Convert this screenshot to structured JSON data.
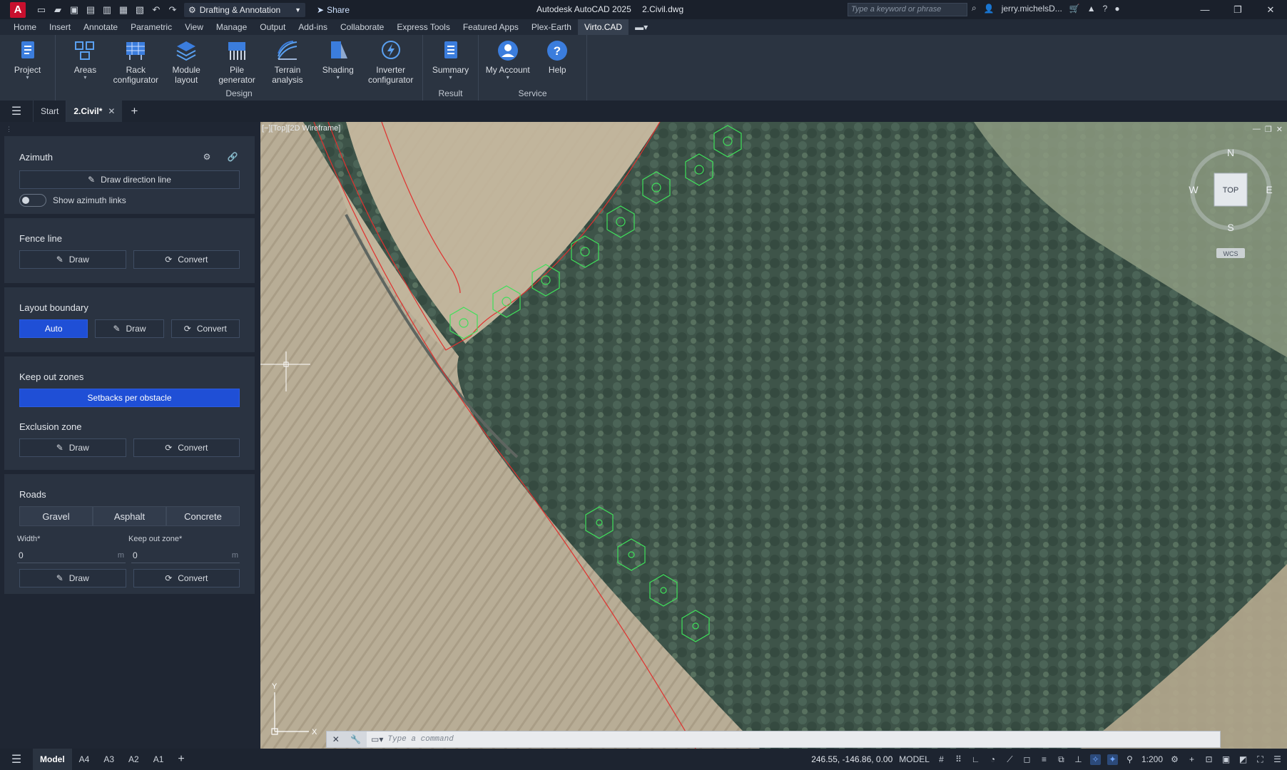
{
  "title": {
    "app": "Autodesk AutoCAD 2025",
    "file": "2.Civil.dwg"
  },
  "workspace": "Drafting & Annotation",
  "share_label": "Share",
  "search_placeholder": "Type a keyword or phrase",
  "user": "jerry.michelsD...",
  "menu": [
    "Home",
    "Insert",
    "Annotate",
    "Parametric",
    "View",
    "Manage",
    "Output",
    "Add-ins",
    "Collaborate",
    "Express Tools",
    "Featured Apps",
    "Plex-Earth",
    "Virto.CAD"
  ],
  "ribbon": {
    "project": "Project",
    "design": [
      "Areas",
      "Rack configurator",
      "Module layout",
      "Pile generator",
      "Terrain analysis",
      "Shading",
      "Inverter configurator"
    ],
    "design_label": "Design",
    "summary": "Summary",
    "result_label": "Result",
    "my_account": "My Account",
    "help": "Help",
    "service_label": "Service"
  },
  "doctabs": {
    "start": "Start",
    "active": "2.Civil*"
  },
  "panel": {
    "azimuth": {
      "title": "Azimuth",
      "draw_direction": "Draw direction line",
      "toggle_label": "Show azimuth links"
    },
    "fence": {
      "title": "Fence line",
      "draw": "Draw",
      "convert": "Convert"
    },
    "boundary": {
      "title": "Layout boundary",
      "auto": "Auto",
      "draw": "Draw",
      "convert": "Convert"
    },
    "keepout": {
      "title": "Keep out zones",
      "setbacks": "Setbacks per obstacle"
    },
    "exclusion": {
      "title": "Exclusion zone",
      "draw": "Draw",
      "convert": "Convert"
    },
    "roads": {
      "title": "Roads",
      "types": [
        "Gravel",
        "Asphalt",
        "Concrete"
      ],
      "width_label": "Width*",
      "keepout_label": "Keep out zone*",
      "width_value": "0",
      "keepout_value": "0",
      "unit": "m",
      "draw": "Draw",
      "convert": "Convert"
    }
  },
  "viewport": {
    "label": "[−][Top][2D Wireframe]",
    "compass": {
      "n": "N",
      "s": "S",
      "e": "E",
      "w": "W",
      "top": "TOP",
      "wcs": "WCS"
    },
    "ucs_x": "X",
    "ucs_y": "Y"
  },
  "cmdline": {
    "placeholder": "Type a command"
  },
  "status": {
    "layouts": [
      "Model",
      "A4",
      "A3",
      "A2",
      "A1"
    ],
    "coords": "246.55, -146.86, 0.00",
    "model": "MODEL",
    "scale": "1:200"
  },
  "colors": {
    "accent": "#1f4fd6",
    "boundary_line": "#e0302e",
    "module_outline": "#3fe05a"
  }
}
